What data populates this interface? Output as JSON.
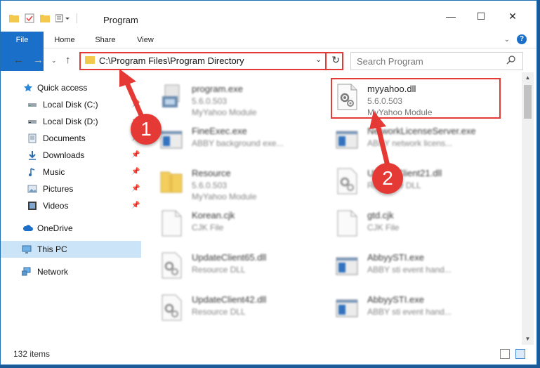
{
  "window": {
    "title": "Program"
  },
  "ribbon": {
    "tabs": [
      "File",
      "Home",
      "Share",
      "View"
    ]
  },
  "address": {
    "path": "C:\\Program Files\\Program Directory"
  },
  "search": {
    "placeholder": "Search Program"
  },
  "nav": {
    "quick_access": "Quick access",
    "items": [
      {
        "label": "Local Disk (C:)",
        "icon": "drive-icon",
        "pinned": true
      },
      {
        "label": "Local Disk (D:)",
        "icon": "drive-icon",
        "pinned": true
      },
      {
        "label": "Documents",
        "icon": "documents-icon",
        "pinned": true
      },
      {
        "label": "Downloads",
        "icon": "download-icon",
        "pinned": true
      },
      {
        "label": "Music",
        "icon": "music-icon",
        "pinned": true
      },
      {
        "label": "Pictures",
        "icon": "pictures-icon",
        "pinned": true
      },
      {
        "label": "Videos",
        "icon": "videos-icon",
        "pinned": true
      }
    ],
    "onedrive": "OneDrive",
    "this_pc": "This PC",
    "network": "Network"
  },
  "files": [
    {
      "name": "program.exe",
      "line2": "5.6.0.503",
      "line3": "MyYahoo Module",
      "icon": "setup-icon"
    },
    {
      "name": "myyahoo.dll",
      "line2": "5.6.0.503",
      "line3": "MyYahoo Module",
      "icon": "dll-gear-icon"
    },
    {
      "name": "FineExec.exe",
      "line2": "ABBY background exe...",
      "line3": "",
      "icon": "window-icon"
    },
    {
      "name": "NetworkLicenseServer.exe",
      "line2": "ABBY network licens...",
      "line3": "",
      "icon": "window-icon"
    },
    {
      "name": "Resource",
      "line2": "5.6.0.503",
      "line3": "MyYahoo Module",
      "icon": "folder-zip-icon"
    },
    {
      "name": "UpdateClient21.dll",
      "line2": "Resource DLL",
      "line3": "",
      "icon": "dll-gear-icon"
    },
    {
      "name": "Korean.cjk",
      "line2": "CJK File",
      "line3": "",
      "icon": "blank-file-icon"
    },
    {
      "name": "gtd.cjk",
      "line2": "CJK File",
      "line3": "",
      "icon": "blank-file-icon"
    },
    {
      "name": "UpdateClient65.dll",
      "line2": "Resource DLL",
      "line3": "",
      "icon": "dll-gear-icon"
    },
    {
      "name": "AbbyySTI.exe",
      "line2": "ABBY sti event hand...",
      "line3": "",
      "icon": "window-icon"
    },
    {
      "name": "UpdateClient42.dll",
      "line2": "Resource DLL",
      "line3": "",
      "icon": "dll-gear-icon"
    },
    {
      "name": "AbbyySTI.exe",
      "line2": "ABBY sti event hand...",
      "line3": "",
      "icon": "window-icon"
    }
  ],
  "status": {
    "item_count": "132 items"
  },
  "annotations": {
    "badge1": "1",
    "badge2": "2"
  },
  "colors": {
    "accent": "#1a6fc9",
    "annotation": "#e53935",
    "selection": "#cce4f7"
  }
}
